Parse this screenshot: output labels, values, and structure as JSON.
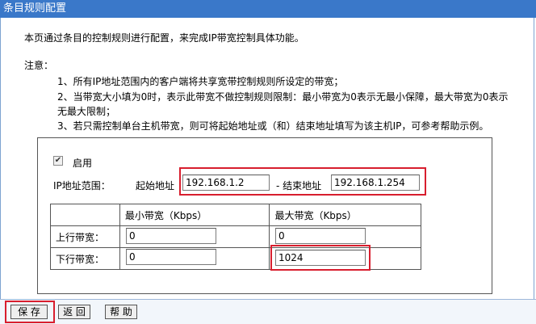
{
  "window": {
    "title": "条目规则配置"
  },
  "intro": "本页通过条目的控制规则进行配置，来完成IP带宽控制具体功能。",
  "notice_label": "注意：",
  "notes": [
    "1、所有IP地址范围内的客户端将共享宽带控制规则所设定的带宽；",
    "2、当带宽大小填为0时，表示此带宽不做控制规则限制：最小带宽为0表示无最小保障，最大带宽为0表示",
    "无最大限制；",
    "3、若只需控制单台主机带宽，则可将起始地址或（和）结束地址填写为该主机IP，可参考帮助示例。"
  ],
  "enable": {
    "label": "启用",
    "checked": true
  },
  "ip_range": {
    "label": "IP地址范围：",
    "start_label": "起始地址",
    "start_value": "192.168.1.2",
    "separator_label": "- 结束地址",
    "end_value": "192.168.1.254"
  },
  "bandwidth": {
    "header_min": "最小带宽（Kbps）",
    "header_max": "最大带宽（Kbps）",
    "rows": [
      {
        "label": "上行带宽：",
        "min": "0",
        "max": "0"
      },
      {
        "label": "下行带宽：",
        "min": "0",
        "max": "1024"
      }
    ]
  },
  "buttons": {
    "save": "保 存",
    "back": "返 回",
    "help": "帮 助"
  },
  "colors": {
    "title_bar": "#3a78c9",
    "highlight": "#d81e2e"
  }
}
